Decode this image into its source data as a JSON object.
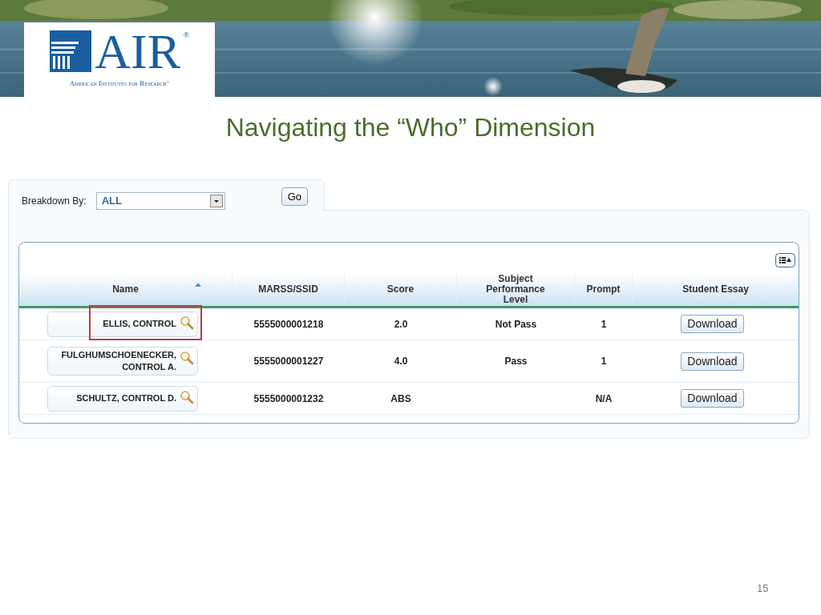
{
  "logo": {
    "wordmark": "AIR",
    "registered": "®",
    "tagline": "American Institutes for Research",
    "tagline_mark": "®"
  },
  "slide_title": "Navigating the “Who” Dimension",
  "filter": {
    "label": "Breakdown By:",
    "value": "ALL",
    "button": "Go"
  },
  "table": {
    "columns": [
      {
        "label": "Name",
        "sorted": true
      },
      {
        "label": "MARSS/SSID",
        "sorted": false
      },
      {
        "label": "Score",
        "sorted": false
      },
      {
        "label": "Subject Performance Level",
        "sorted": false
      },
      {
        "label": "Prompt",
        "sorted": false
      },
      {
        "label": "Student Essay",
        "sorted": false
      }
    ],
    "rows": [
      {
        "name": "ELLIS, CONTROL",
        "id": "5555000001218",
        "score": "2.0",
        "level": "Not Pass",
        "prompt": "1",
        "essay": "Download",
        "highlighted": true
      },
      {
        "name": "FULGHUMSCHOENECKER, CONTROL A.",
        "id": "5555000001227",
        "score": "4.0",
        "level": "Pass",
        "prompt": "1",
        "essay": "Download",
        "highlighted": false
      },
      {
        "name": "SCHULTZ, CONTROL D.",
        "id": "5555000001232",
        "score": "ABS",
        "prompt": "N/A",
        "essay": "Download",
        "highlighted": false
      }
    ]
  },
  "page_number": "15"
}
